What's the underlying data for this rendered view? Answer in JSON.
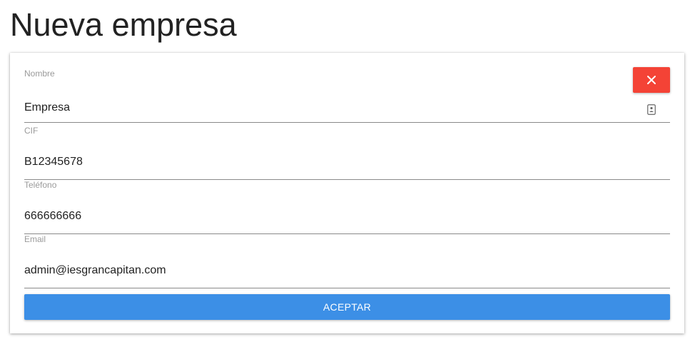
{
  "page": {
    "title": "Nueva empresa"
  },
  "form": {
    "fields": [
      {
        "label": "Nombre",
        "value": "Empresa"
      },
      {
        "label": "CIF",
        "value": "B12345678"
      },
      {
        "label": "Teléfono",
        "value": "666666666"
      },
      {
        "label": "Email",
        "value": "admin@iesgrancapitan.com"
      }
    ],
    "accept_label": "ACEPTAR",
    "close_icon": "close-icon",
    "contact_icon": "contact-card-icon"
  },
  "colors": {
    "close_button": "#f44336",
    "accept_button": "#3c8fe6"
  }
}
